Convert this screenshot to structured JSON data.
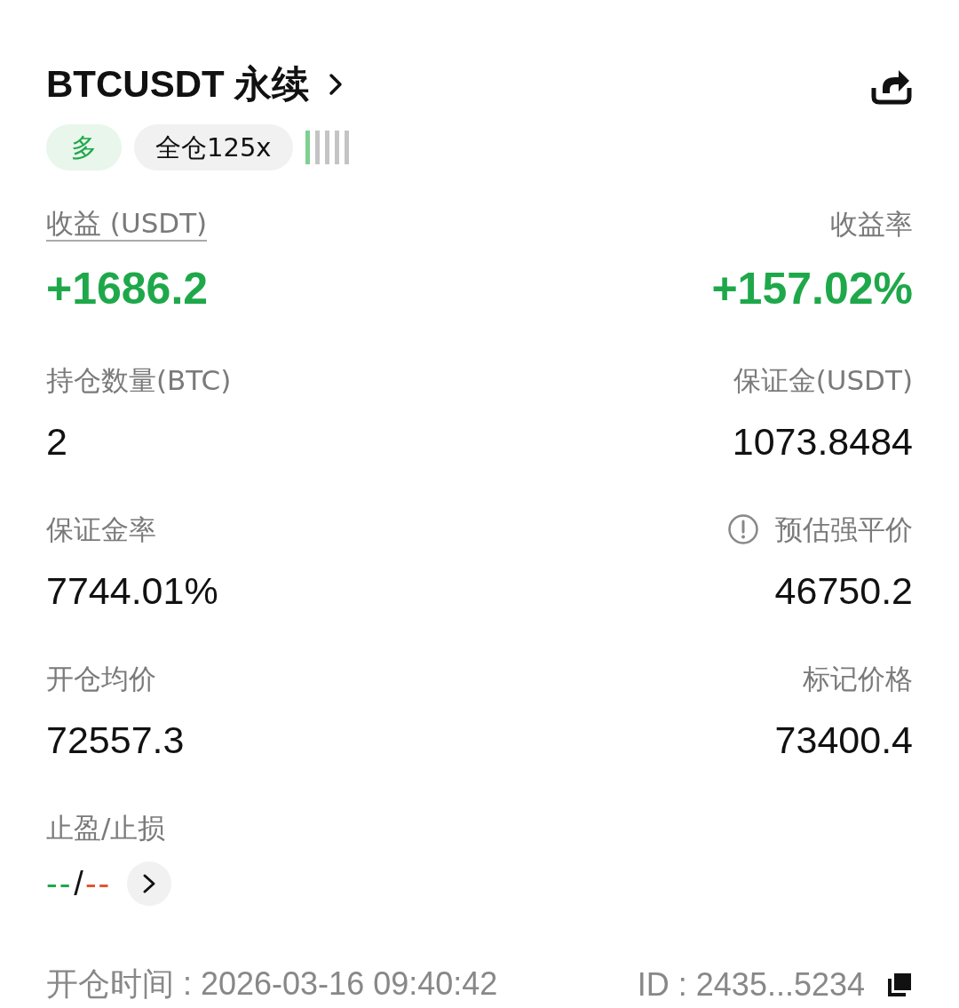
{
  "header": {
    "title": "BTCUSDT 永续"
  },
  "tags": [
    {
      "kind": "side",
      "text": "多"
    },
    {
      "kind": "margin",
      "text": "全仓125x"
    }
  ],
  "pnl": {
    "label": "收益 (USDT)",
    "value": "+1686.2",
    "rate_label": "收益率",
    "rate": "+157.02%"
  },
  "stats": [
    {
      "kind": "plain",
      "label": "持仓数量(BTC)",
      "value": "2"
    },
    {
      "kind": "plain",
      "label": "保证金(USDT)",
      "value": "1073.8484"
    },
    {
      "kind": "plain",
      "label": "保证金率",
      "value": "7744.01%"
    },
    {
      "kind": "info",
      "label": "预估强平价",
      "value": "46750.2"
    },
    {
      "kind": "plain",
      "label": "开仓均价",
      "value": "72557.3"
    },
    {
      "kind": "plain",
      "label": "标记价格",
      "value": "73400.4"
    }
  ],
  "tpsl": {
    "label": "止盈/止损",
    "take_profit": "--",
    "separator": "/",
    "stop_loss": "--"
  },
  "footer": {
    "open_time": "开仓时间 : 2026-03-16 09:40:42",
    "id": "ID : 2435...5234"
  }
}
